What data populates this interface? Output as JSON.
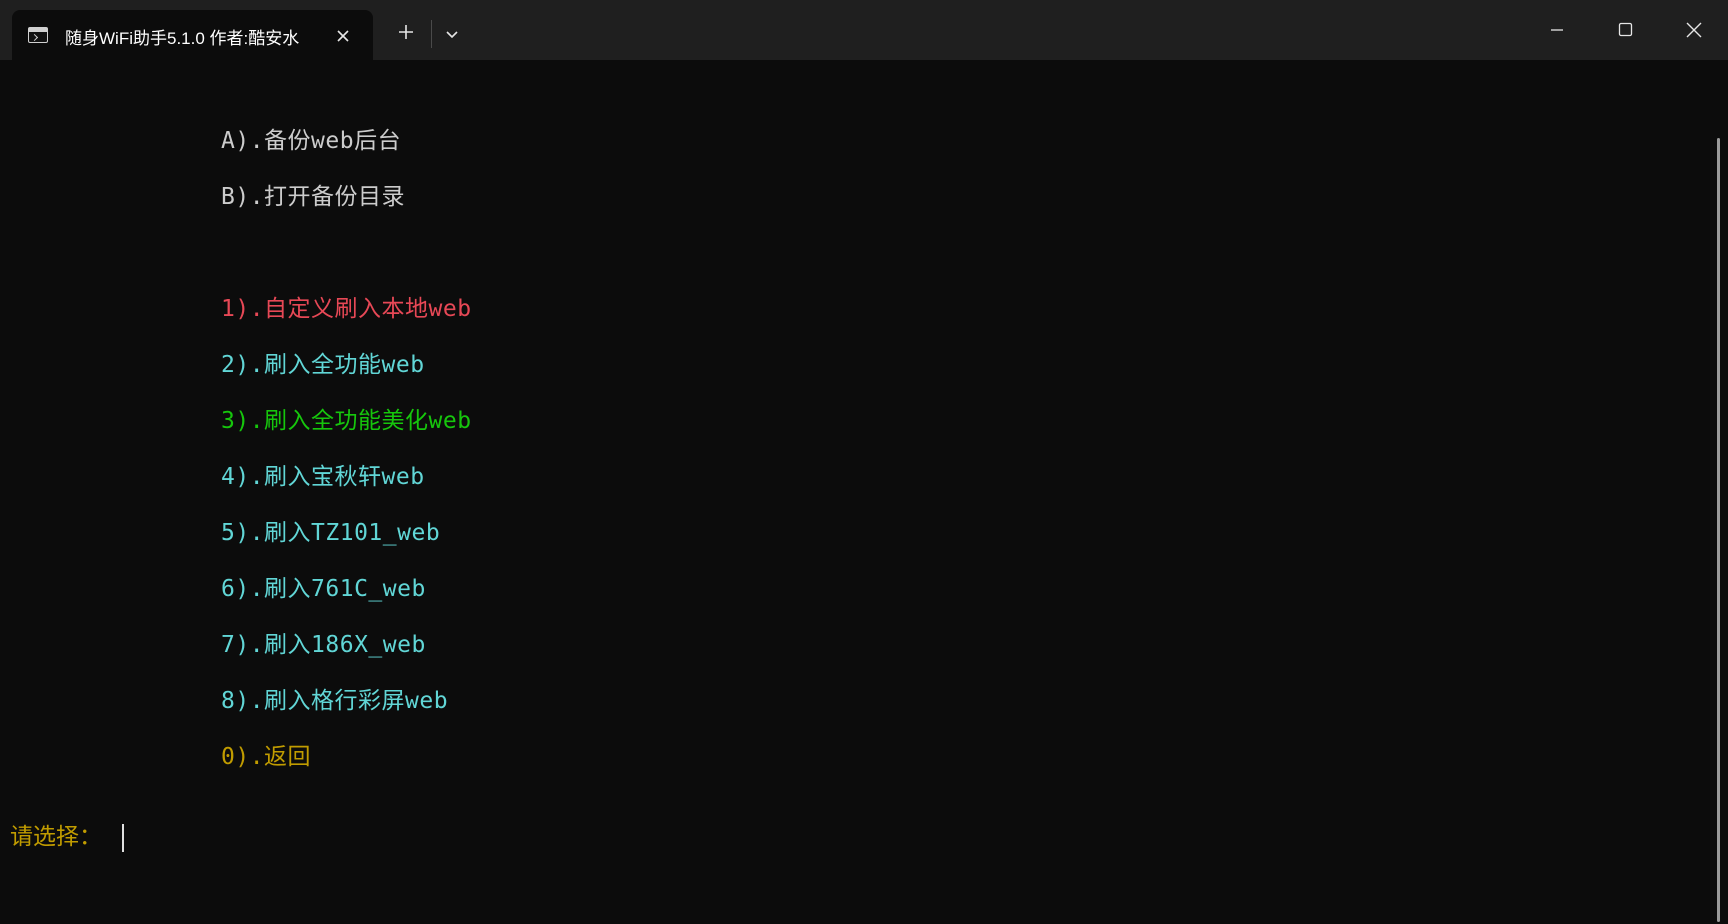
{
  "window": {
    "tab_title": "随身WiFi助手5.1.0 作者:酷安水"
  },
  "icons": {
    "terminal": "terminal-icon",
    "close_tab": "close-icon",
    "new_tab": "plus-icon",
    "dropdown": "chevron-down-icon",
    "minimize": "minimize-icon",
    "maximize": "maximize-icon",
    "close_window": "close-icon"
  },
  "colors": {
    "background": "#0c0c0c",
    "white": "#cccccc",
    "red": "#e74856",
    "cyan": "#61d6d6",
    "green": "#16c60c",
    "yellow": "#c19c00"
  },
  "menu": {
    "items": [
      {
        "label": "A).备份web后台",
        "color": "#cccccc"
      },
      {
        "label": "B).打开备份目录",
        "color": "#cccccc"
      },
      {
        "label": "1).自定义刷入本地web",
        "color": "#e74856"
      },
      {
        "label": "2).刷入全功能web",
        "color": "#61d6d6"
      },
      {
        "label": "3).刷入全功能美化web",
        "color": "#16c60c"
      },
      {
        "label": "4).刷入宝秋轩web",
        "color": "#61d6d6"
      },
      {
        "label": "5).刷入TZ101_web",
        "color": "#61d6d6"
      },
      {
        "label": "6).刷入761C_web",
        "color": "#61d6d6"
      },
      {
        "label": "7).刷入186X_web",
        "color": "#61d6d6"
      },
      {
        "label": "8).刷入格行彩屏web",
        "color": "#61d6d6"
      },
      {
        "label": "0).返回",
        "color": "#c19c00"
      }
    ]
  },
  "prompt": {
    "label": "请选择：",
    "color": "#c19c00"
  }
}
